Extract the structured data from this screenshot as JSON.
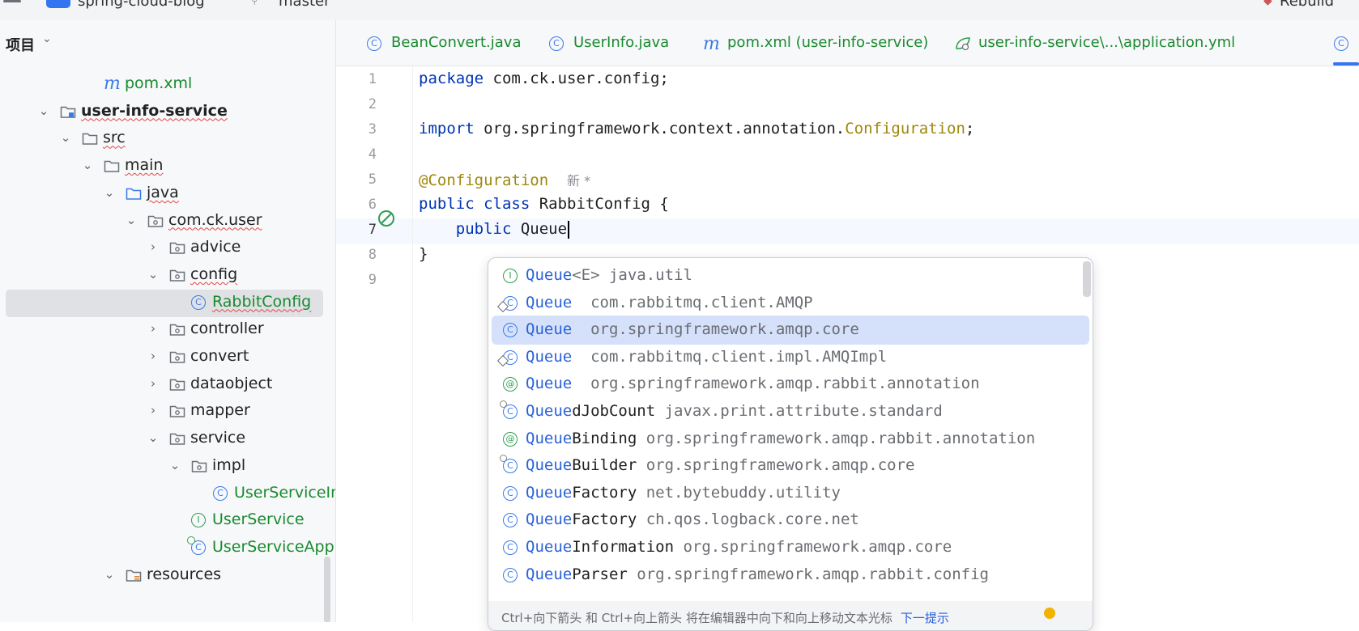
{
  "titlebar": {
    "project_name": "spring-cloud-blog",
    "branch": "master",
    "right_text": "Rebuild"
  },
  "sidebar": {
    "title": "项目",
    "items": [
      {
        "label": "pom.xml",
        "icon": "maven-icon",
        "expanded": null,
        "style": "green"
      },
      {
        "label": "user-info-service",
        "icon": "module-folder-icon",
        "expanded": true,
        "style": "bold"
      },
      {
        "label": "src",
        "icon": "folder-icon",
        "expanded": true,
        "style": "plain"
      },
      {
        "label": "main",
        "icon": "folder-icon",
        "expanded": true,
        "style": "plain"
      },
      {
        "label": "java",
        "icon": "source-folder-icon",
        "expanded": true,
        "style": "plain"
      },
      {
        "label": "com.ck.user",
        "icon": "package-icon",
        "expanded": true,
        "style": "plain"
      },
      {
        "label": "advice",
        "icon": "package-icon",
        "expanded": false,
        "style": "plain"
      },
      {
        "label": "config",
        "icon": "package-icon",
        "expanded": true,
        "style": "plain"
      },
      {
        "label": "RabbitConfig",
        "icon": "class-icon",
        "expanded": null,
        "style": "green"
      },
      {
        "label": "controller",
        "icon": "package-icon",
        "expanded": false,
        "style": "plain"
      },
      {
        "label": "convert",
        "icon": "package-icon",
        "expanded": false,
        "style": "plain"
      },
      {
        "label": "dataobject",
        "icon": "package-icon",
        "expanded": false,
        "style": "plain"
      },
      {
        "label": "mapper",
        "icon": "package-icon",
        "expanded": false,
        "style": "plain"
      },
      {
        "label": "service",
        "icon": "package-icon",
        "expanded": true,
        "style": "plain"
      },
      {
        "label": "impl",
        "icon": "package-icon",
        "expanded": true,
        "style": "plain"
      },
      {
        "label": "UserServiceImpl",
        "icon": "class-icon",
        "expanded": null,
        "style": "green"
      },
      {
        "label": "UserService",
        "icon": "interface-icon",
        "expanded": null,
        "style": "green"
      },
      {
        "label": "UserServiceApplication",
        "icon": "spring-boot-class-icon",
        "expanded": null,
        "style": "green"
      },
      {
        "label": "resources",
        "icon": "resources-folder-icon",
        "expanded": true,
        "style": "plain"
      }
    ]
  },
  "tabs": [
    {
      "label": "BeanConvert.java",
      "icon": "class-icon"
    },
    {
      "label": "UserInfo.java",
      "icon": "class-icon"
    },
    {
      "label": "pom.xml (user-info-service)",
      "icon": "maven-icon"
    },
    {
      "label": "user-info-service\\...\\application.yml",
      "icon": "spring-yml-icon"
    }
  ],
  "editor": {
    "line_numbers": [
      "1",
      "2",
      "3",
      "4",
      "5",
      "6",
      "7",
      "8",
      "9"
    ],
    "lines": {
      "l1_kw": "package",
      "l1_rest": " com.ck.user.config;",
      "l3_kw": "import",
      "l3_pkg": " org.springframework.context.annotation.",
      "l3_cls": "Configuration",
      "l3_end": ";",
      "l5_ann": "@Configuration",
      "l5_hint": "新 *",
      "l6_kw": "public class",
      "l6_rest": " RabbitConfig {",
      "l7_kw": "public",
      "l7_rest": " Queue",
      "l8": "}"
    }
  },
  "completion": {
    "typed": "Queue",
    "items": [
      {
        "match": "Queue",
        "rest": "<E>",
        "pkg": " java.util",
        "icon": "interface-icon"
      },
      {
        "match": "Queue",
        "rest": "",
        "pkg": "  com.rabbitmq.client.AMQP",
        "icon": "class-inner-icon"
      },
      {
        "match": "Queue",
        "rest": "",
        "pkg": "  org.springframework.amqp.core",
        "icon": "class-icon"
      },
      {
        "match": "Queue",
        "rest": "",
        "pkg": "  com.rabbitmq.client.impl.AMQImpl",
        "icon": "class-inner-icon"
      },
      {
        "match": "Queue",
        "rest": "",
        "pkg": "  org.springframework.amqp.rabbit.annotation",
        "icon": "annotation-icon"
      },
      {
        "match": "Queue",
        "rest": "dJobCount",
        "pkg": " javax.print.attribute.standard",
        "icon": "class-final-icon"
      },
      {
        "match": "Queue",
        "rest": "Binding",
        "pkg": " org.springframework.amqp.rabbit.annotation",
        "icon": "annotation-icon"
      },
      {
        "match": "Queue",
        "rest": "Builder",
        "pkg": " org.springframework.amqp.core",
        "icon": "class-final-icon"
      },
      {
        "match": "Queue",
        "rest": "Factory",
        "pkg": " net.bytebuddy.utility",
        "icon": "class-icon"
      },
      {
        "match": "Queue",
        "rest": "Factory",
        "pkg": " ch.qos.logback.core.net",
        "icon": "class-icon"
      },
      {
        "match": "Queue",
        "rest": "Information",
        "pkg": " org.springframework.amqp.core",
        "icon": "class-icon"
      },
      {
        "match": "Queue",
        "rest": "Parser",
        "pkg": " org.springframework.amqp.rabbit.config",
        "icon": "class-icon"
      }
    ],
    "selected_index": 2,
    "footer_text": "Ctrl+向下箭头 和 Ctrl+向上箭头 将在编辑器中向下和向上移动文本光标",
    "footer_link": "下一提示"
  },
  "colors": {
    "accent": "#3574f0",
    "green_file": "#1a8a2e",
    "keyword": "#0033b3",
    "annotation": "#9e880d",
    "selection": "#d5e1fb"
  }
}
